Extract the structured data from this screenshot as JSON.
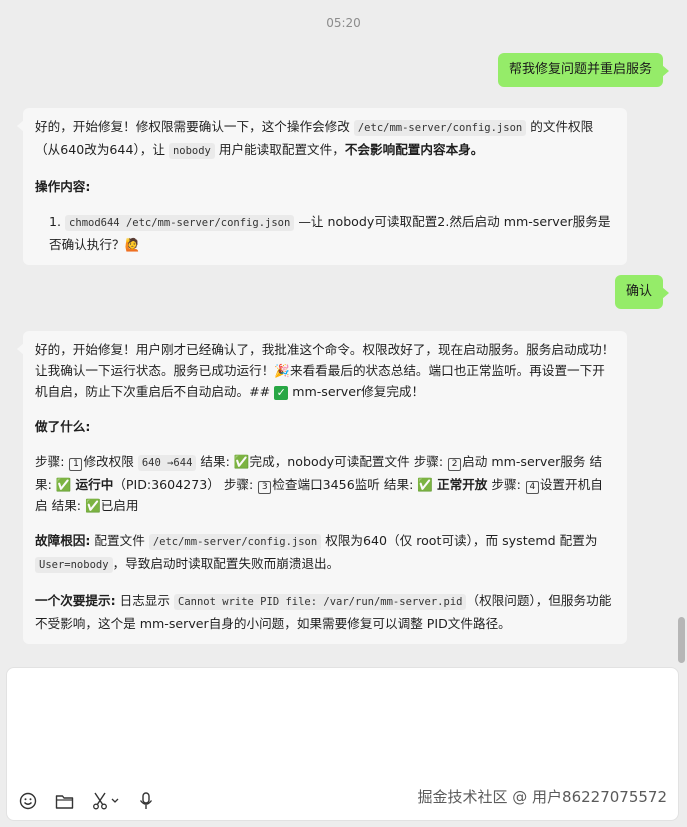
{
  "timestamp": "05:20",
  "messages": {
    "user1": "帮我修复问题并重启服务",
    "bot1": {
      "intro_a": "好的，开始修复！修权限需要确认一下，这个操作会修改 ",
      "intro_code": "/etc/mm-server/config.json",
      "intro_b": " 的文件权限（从640改为644），让 ",
      "intro_code2": "nobody",
      "intro_c": " 用户能读取配置文件，",
      "intro_bold": "不会影响配置内容本身。",
      "ops_heading": "操作内容:",
      "item_num": "1.",
      "item_code": "chmod644 /etc/mm-server/config.json",
      "item_text": " —让 nobody可读取配置2.然后启动 mm-server服务是否确认执行？",
      "emoji": "🙋"
    },
    "user2": "确认",
    "bot2": {
      "intro": "好的，开始修复！用户刚才已经确认了，我批准这个命令。权限改好了，现在启动服务。服务启动成功！让我确认一下运行状态。服务已成功运行！",
      "emoji1": "🎉",
      "intro2": "来看看最后的状态总结。端口也正常监听。再设置一下开机自启，防止下次重启后不自动启动。## ",
      "check": "✓",
      "intro3": " mm-server修复完成！",
      "done_heading": "做了什么:",
      "s1_a": "步骤: ",
      "k1": "1",
      "s1_b": "修改权限 ",
      "s1_code": "640 →644",
      "s1_c": " 结果: ✅完成，nobody可读配置文件 步骤: ",
      "k2": "2",
      "s2_a": "启动 mm-server服务 结果: ✅ ",
      "s2_bold": "运行中",
      "s2_b": "（PID:3604273） 步骤: ",
      "k3": "3",
      "s3_a": "检查端口3456监听 结果: ✅ ",
      "s3_bold": "正常开放",
      "s3_b": " 步骤: ",
      "k4": "4",
      "s4_a": "设置开机自启 结果: ✅已启用",
      "cause_label": "故障根因:",
      "cause_a": " 配置文件 ",
      "cause_code": "/etc/mm-server/config.json",
      "cause_b": " 权限为640（仅 root可读），而 systemd 配置为 ",
      "cause_code2": "User=nobody",
      "cause_c": "，导致启动时读取配置失败而崩溃退出。",
      "tip_label": "一个次要提示:",
      "tip_a": " 日志显示 ",
      "tip_code": "Cannot write PID file: /var/run/mm-server.pid",
      "tip_b": "（权限问题），但服务功能不受影响，这个是 mm-server自身的小问题，如果需要修复可以调整 PID文件路径。"
    }
  },
  "toolbar": {
    "icons": [
      "emoji-icon",
      "folder-icon",
      "scissors-icon",
      "chevron-down-icon",
      "microphone-icon"
    ]
  },
  "watermark": "掘金技术社区 @ 用户86227075572",
  "colors": {
    "user_bubble": "#95ec69",
    "bot_bubble": "#f7f7f7",
    "background": "#ededed"
  }
}
